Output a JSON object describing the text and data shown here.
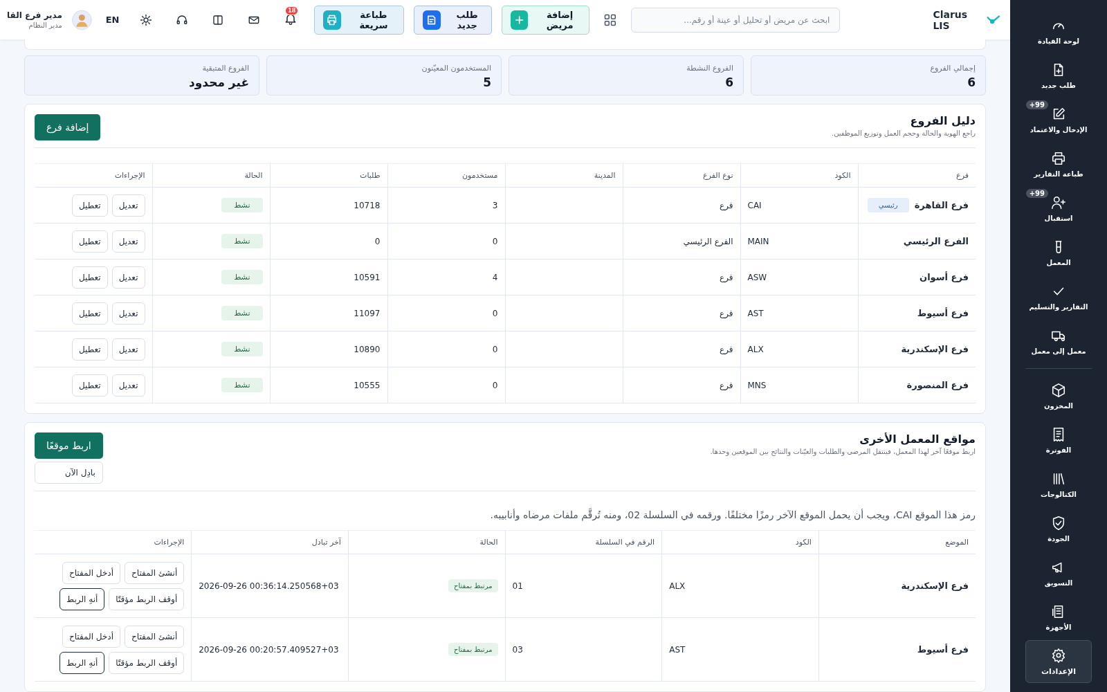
{
  "topbar": {
    "brand": "Clarus LIS",
    "search": {
      "placeholder": "ابحث عن مريض أو تحليل أو عينة أو رقم..."
    },
    "actions": [
      {
        "label": "إضافة مريض",
        "kind": "add"
      },
      {
        "label": "طلب جديد",
        "kind": "request"
      },
      {
        "label": "طباعة سريعة",
        "kind": "print"
      }
    ],
    "notifications": {
      "count": "18"
    },
    "language": "EN",
    "user": {
      "name": "مدير فرع القا",
      "role": "مدير النظام"
    }
  },
  "sidebar": {
    "groups": [
      [
        {
          "label": "لوحة القيادة",
          "kind": "gauge",
          "selected": false
        },
        {
          "label": "طلب جديد",
          "kind": "file-plus",
          "selected": false
        },
        {
          "label": "الإدخال والاعتماد",
          "kind": "edit",
          "badge": "+99",
          "selected": false
        },
        {
          "label": "طباعة التقارير",
          "kind": "printer",
          "selected": false
        },
        {
          "label": "استقبال",
          "kind": "user-plus",
          "badge": "+99",
          "selected": false
        },
        {
          "label": "المعمل",
          "kind": "tube",
          "selected": false
        },
        {
          "label": "التقارير والتسليم",
          "kind": "check",
          "selected": false
        },
        {
          "label": "معمل إلى معمل",
          "kind": "truck",
          "selected": false
        }
      ],
      [
        {
          "label": "المخزون",
          "kind": "box",
          "selected": false
        },
        {
          "label": "الفوترة",
          "kind": "receipt",
          "selected": false
        },
        {
          "label": "الكتالوجات",
          "kind": "books",
          "selected": false
        },
        {
          "label": "الجودة",
          "kind": "shield",
          "selected": false
        },
        {
          "label": "التسويق",
          "kind": "megaphone",
          "selected": false
        },
        {
          "label": "الأجهزة",
          "kind": "device",
          "selected": false
        },
        {
          "label": "الإعدادات",
          "kind": "gear",
          "selected": true
        }
      ]
    ]
  },
  "stats": [
    {
      "label": "إجمالي الفروع",
      "value": "6"
    },
    {
      "label": "الفروع النشطة",
      "value": "6"
    },
    {
      "label": "المستخدمون المعيّنون",
      "value": "5"
    },
    {
      "label": "الفروع المتبقية",
      "value": "غير محدود"
    }
  ],
  "branches": {
    "title": "دليل الفروع",
    "subtitle": "راجع الهوية والحالة وحجم العمل وتوزيع الموظفين.",
    "add_button": "إضافة فرع",
    "columns": [
      "فرع",
      "الكود",
      "نوع الفرع",
      "المدينة",
      "مستخدمون",
      "طلبات",
      "الحالة",
      "الإجراءات"
    ],
    "rows": [
      {
        "name": "فرع القاهرة",
        "tag": "رئيسي",
        "code": "CAI",
        "type": "فرع",
        "users": "3",
        "requests": "10718",
        "status": "نشط",
        "actions": [
          "تعديل",
          "تعطيل"
        ]
      },
      {
        "name": "الفرع الرئيسي",
        "code": "MAIN",
        "type": "الفرع الرئيسي",
        "users": "0",
        "requests": "0",
        "status": "نشط",
        "actions": [
          "تعديل",
          "تعطيل"
        ]
      },
      {
        "name": "فرع أسوان",
        "code": "ASW",
        "type": "فرع",
        "users": "4",
        "requests": "10591",
        "status": "نشط",
        "actions": [
          "تعديل",
          "تعطيل"
        ]
      },
      {
        "name": "فرع أسيوط",
        "code": "AST",
        "type": "فرع",
        "users": "0",
        "requests": "11097",
        "status": "نشط",
        "actions": [
          "تعديل",
          "تعطيل"
        ]
      },
      {
        "name": "فرع الإسكندرية",
        "code": "ALX",
        "type": "فرع",
        "users": "0",
        "requests": "10890",
        "status": "نشط",
        "actions": [
          "تعديل",
          "تعطيل"
        ]
      },
      {
        "name": "فرع المنصورة",
        "code": "MNS",
        "type": "فرع",
        "users": "0",
        "requests": "10555",
        "status": "نشط",
        "actions": [
          "تعديل",
          "تعطيل"
        ]
      }
    ]
  },
  "sites": {
    "title": "مواقع المعمل الأخرى",
    "subtitle": "اربط موقعًا آخر لهذا المعمل، فينتقل المرضى والطلبات والعيّنات والنتائج بين الموقعين وحدها.",
    "link_button": "اربط موقعًا",
    "exchange_button": "بادِل الآن",
    "note": "رمز هذا الموقع CAI، ويجب أن يحمل الموقع الآخر رمزًا مختلفًا. ورقمه في السلسلة 02، ومنه تُرقَّم ملفات مرضاه وأنابيبه.",
    "columns": [
      "الموضع",
      "الكود",
      "الرقم في السلسلة",
      "الحالة",
      "آخر تبادل",
      "الإجراءات"
    ],
    "rows": [
      {
        "name": "فرع الإسكندرية",
        "code": "ALX",
        "serial": "01",
        "status": "مرتبط بمفتاح",
        "last_exchange": "2026-09-26 00:36:14.250568+03",
        "actions": [
          {
            "label": "أنشئ المفتاح",
            "kind": "plain"
          },
          {
            "label": "أدخل المفتاح",
            "kind": "plain"
          },
          {
            "label": "أوقف الربط مؤقتًا",
            "kind": "plain"
          },
          {
            "label": "أنهِ الربط",
            "kind": "strong"
          }
        ]
      },
      {
        "name": "فرع أسيوط",
        "code": "AST",
        "serial": "03",
        "status": "مرتبط بمفتاح",
        "last_exchange": "2026-09-26 00:20:57.409527+03",
        "actions": [
          {
            "label": "أنشئ المفتاح",
            "kind": "plain"
          },
          {
            "label": "أدخل المفتاح",
            "kind": "plain"
          },
          {
            "label": "أوقف الربط مؤقتًا",
            "kind": "plain"
          },
          {
            "label": "أنهِ الربط",
            "kind": "strong"
          }
        ]
      }
    ]
  }
}
